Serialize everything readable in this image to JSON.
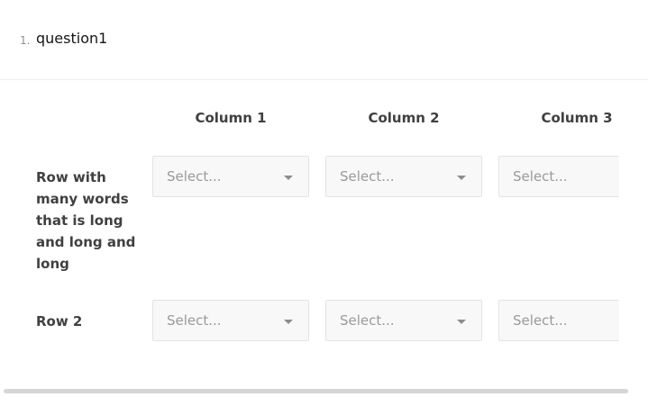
{
  "question": {
    "number": "1.",
    "title": "question1"
  },
  "columns": [
    {
      "label": "Column 1"
    },
    {
      "label": "Column 2"
    },
    {
      "label": "Column 3"
    }
  ],
  "rows": [
    {
      "label": "Row with many words that is long and long and long"
    },
    {
      "label": "Row 2"
    }
  ],
  "dropdown": {
    "placeholder": "Select..."
  }
}
